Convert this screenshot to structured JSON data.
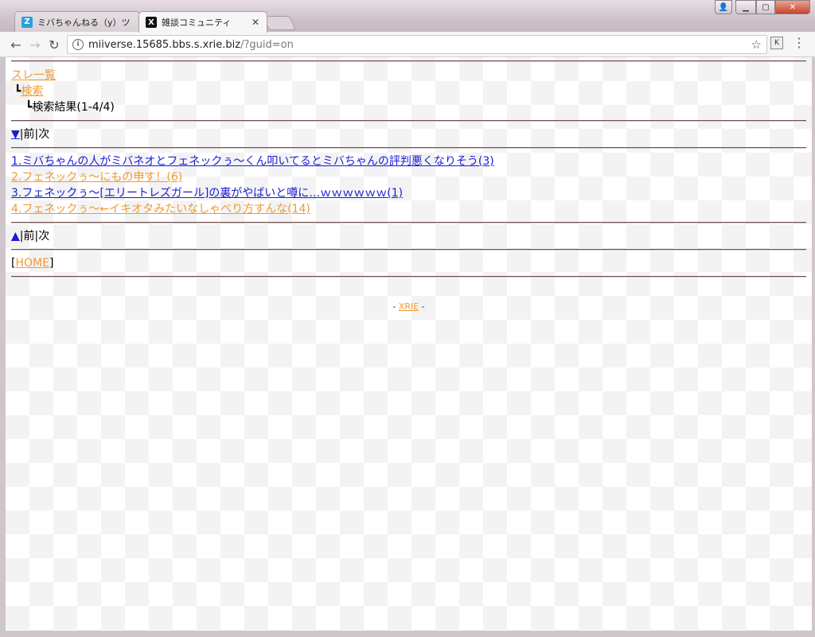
{
  "browser": {
    "tabs": [
      {
        "title": "ミバちゃんねる（y）ツ",
        "favicon": "Z",
        "favicon_color": "#2aa0d8"
      },
      {
        "title": "雑談コミュニティ",
        "favicon": "X",
        "favicon_color": "#111111"
      }
    ],
    "url_host": "miiverse.15685.bbs.s.xrie.biz",
    "url_path": "/?guid=on"
  },
  "page": {
    "breadcrumb": {
      "thread_list": "スレ一覧",
      "search_prefix": "┗",
      "search": "検索",
      "result_prefix": "┗",
      "result": "検索結果(1-4/4)"
    },
    "top_nav": {
      "arrow": "▼",
      "sep1": "|",
      "prev": "前",
      "sep2": "|",
      "next": "次"
    },
    "results": [
      {
        "text": "1.ミバちゃんの人がミバネオとフェネックぅ～くん叩いてるとミバちゃんの評判悪くなりそう(3)",
        "color": "blue"
      },
      {
        "text": "2.フェネックぅ～にもの申す！(6)",
        "color": "orange"
      },
      {
        "text": "3.フェネックぅ～[エリートレズガール]の裏がやばいと噂に…ｗｗｗｗｗｗ(1)",
        "color": "blue"
      },
      {
        "text": "4.フェネックぅ～←イキオタみたいなしゃべり方すんな(14)",
        "color": "orange"
      }
    ],
    "bottom_nav": {
      "arrow": "▲",
      "sep1": "|",
      "prev": "前",
      "sep2": "|",
      "next": "次"
    },
    "home": {
      "open": "[",
      "label": "HOME",
      "close": "]"
    },
    "footer": {
      "left": "- ",
      "link": "XRIE",
      "right": " -"
    }
  }
}
